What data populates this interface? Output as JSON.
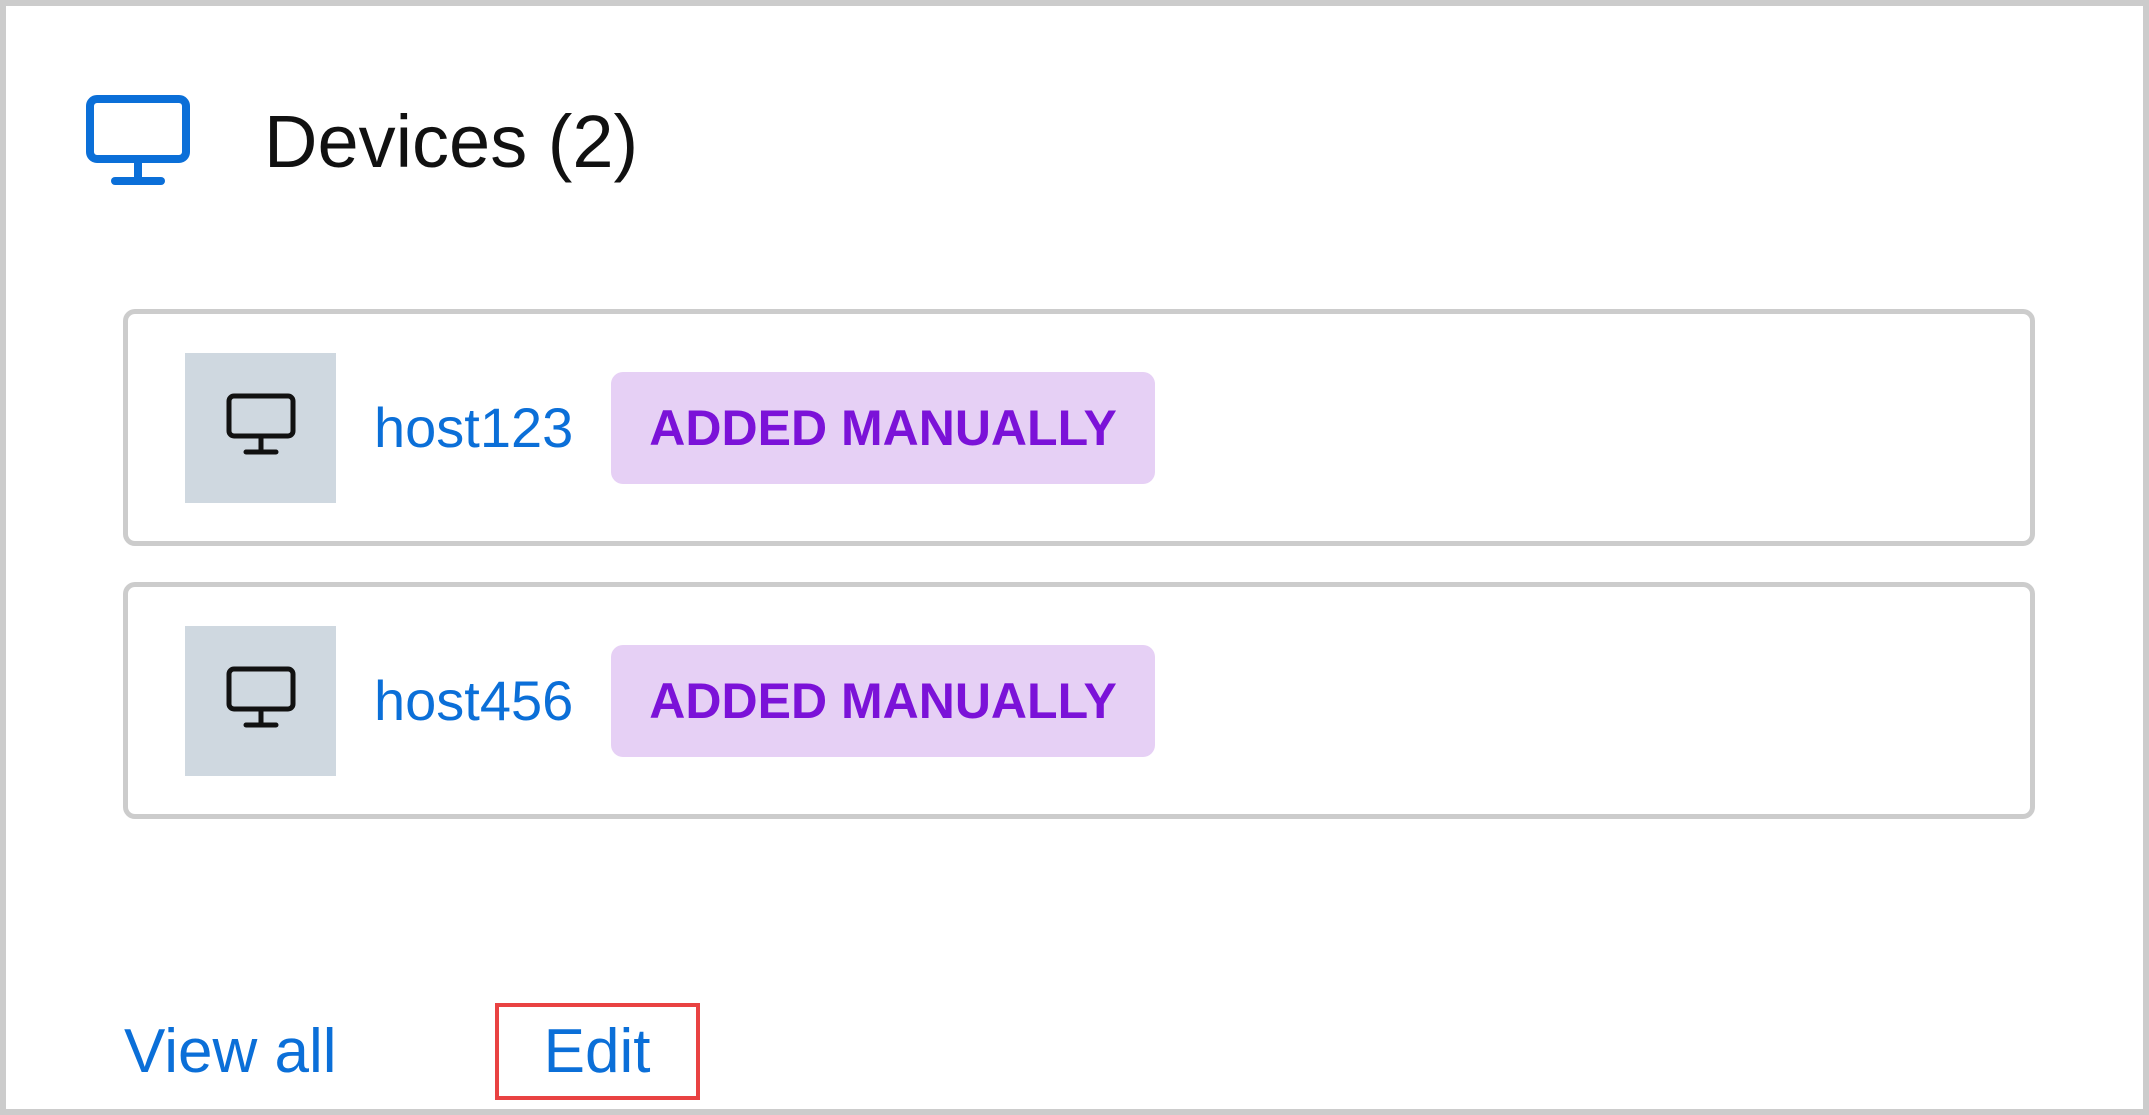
{
  "header": {
    "title": "Devices (2)",
    "icon": "monitor-icon",
    "accent_color": "#0b6fd8"
  },
  "devices": [
    {
      "name": "host123",
      "badge": "ADDED MANUALLY",
      "icon": "monitor-icon"
    },
    {
      "name": "host456",
      "badge": "ADDED MANUALLY",
      "icon": "monitor-icon"
    }
  ],
  "footer": {
    "view_all_label": "View all",
    "edit_label": "Edit"
  },
  "colors": {
    "badge_background": "#e6d0f5",
    "badge_text": "#7b12d8",
    "link": "#0b6fd8",
    "thumb_background": "#cfd8e0",
    "highlight_border": "#e94242"
  }
}
